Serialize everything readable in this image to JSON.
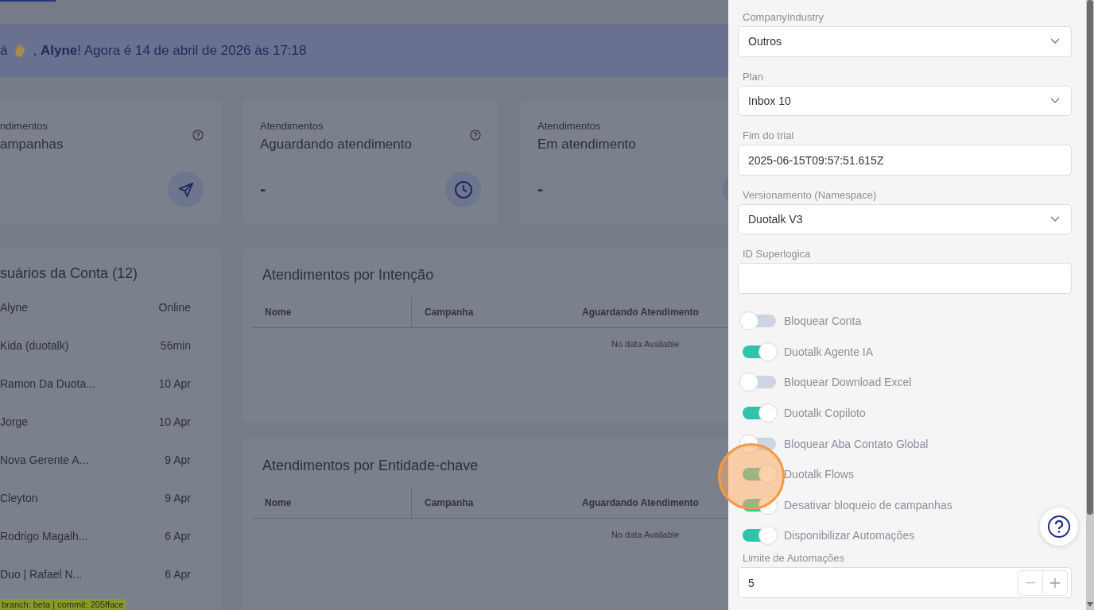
{
  "banner": {
    "before": "á",
    "after": ", **Alyne**! Agora é 14 de abril de 2026 às 17:18"
  },
  "stat_cards": [
    {
      "category": "ndimentos",
      "title": "ampanhas",
      "kind": "send"
    },
    {
      "category": "Atendimentos",
      "title": "Aguardando atendimento",
      "value": "-",
      "kind": "clock"
    },
    {
      "category": "Atendimentos",
      "title": "Em atendimento",
      "value": "-",
      "kind": "blank"
    }
  ],
  "users": {
    "title": "suários da Conta (12)",
    "items": [
      {
        "name": "Alyne",
        "time": "Online"
      },
      {
        "name": "Kida (duotalk)",
        "time": "56min"
      },
      {
        "name": "Ramon Da Duota...",
        "time": "10 Apr"
      },
      {
        "name": "Jorge",
        "time": "10 Apr"
      },
      {
        "name": "Nova Gerente A...",
        "time": "9 Apr"
      },
      {
        "name": "Cleyton",
        "time": "9 Apr"
      },
      {
        "name": "Rodrigo Magalh...",
        "time": "6 Apr"
      },
      {
        "name": "Duo | Rafael N...",
        "time": "6 Apr"
      }
    ]
  },
  "tables": [
    {
      "title": "Atendimentos por Intenção",
      "columns": [
        "Nome",
        "Campanha",
        "Aguardando Atendimento"
      ],
      "empty_text": "No data Available"
    },
    {
      "title": "Atendimentos por Entidade-chave",
      "columns": [
        "Nome",
        "Campanha",
        "Aguardando Atendimento"
      ],
      "empty_text": "No data Available"
    }
  ],
  "build_tag": "branch: beta | commit: 205fface",
  "drawer": {
    "fields": [
      {
        "kind": "select",
        "label": "CompanyIndustry",
        "value": "Outros"
      },
      {
        "kind": "select",
        "label": "Plan",
        "value": "Inbox 10"
      },
      {
        "kind": "text",
        "label": "Fim do trial",
        "value": "2025-06-15T09:57:51.615Z"
      },
      {
        "kind": "select",
        "label": "Versionamento (Namespace)",
        "value": "Duotalk V3"
      },
      {
        "kind": "text",
        "label": "ID Superlogica"
      },
      {
        "kind": "toggle",
        "label": "Bloquear Conta",
        "on": false
      },
      {
        "kind": "toggle",
        "label": "Duotalk Agente IA",
        "on": true
      },
      {
        "kind": "toggle",
        "label": "Bloquear Download Excel",
        "on": false
      },
      {
        "kind": "toggle",
        "label": "Duotalk Copiloto",
        "on": true
      },
      {
        "kind": "toggle",
        "label": "Bloquear Aba Contato Global",
        "on": false
      },
      {
        "kind": "toggle",
        "label": "Duotalk Flows",
        "on": true
      },
      {
        "kind": "toggle",
        "label": "Desativar bloqueio de campanhas",
        "on": true
      },
      {
        "kind": "toggle",
        "label": "Disponibilizar Automações",
        "on": true
      },
      {
        "kind": "number",
        "label": "Limite de Automações",
        "value": "5"
      }
    ]
  }
}
